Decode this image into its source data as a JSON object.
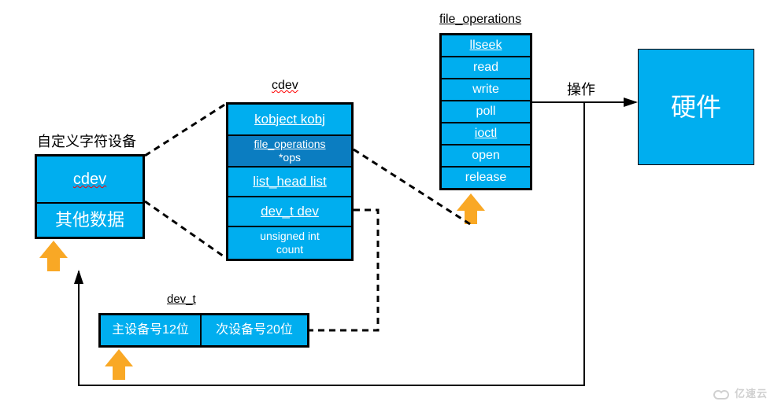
{
  "labels": {
    "custom_device": "自定义字符设备",
    "cdev_title": "cdev",
    "file_ops_title": "file_operations",
    "dev_t_title": "dev_t",
    "operate": "操作",
    "hardware": "硬件",
    "watermark": "亿速云"
  },
  "custom_box": {
    "row1": "cdev",
    "row2": "其他数据"
  },
  "cdev_struct": {
    "r1": "kobject kobj",
    "r2a": "file_operations",
    "r2b": "*ops",
    "r3": "list_head list",
    "r4": "dev_t dev",
    "r5a": "unsigned int",
    "r5b": "count"
  },
  "file_ops": {
    "r1": "llseek",
    "r2": "read",
    "r3": "write",
    "r4": "poll",
    "r5": "ioctl",
    "r6": "open",
    "r7": "release"
  },
  "dev_t": {
    "major": "主设备号12位",
    "minor": "次设备号20位"
  },
  "chart_data": {
    "type": "diagram",
    "nodes": [
      {
        "id": "custom",
        "label": "自定义字符设备",
        "fields": [
          "cdev",
          "其他数据"
        ]
      },
      {
        "id": "cdev",
        "label": "cdev",
        "fields": [
          "kobject kobj",
          "file_operations *ops",
          "list_head list",
          "dev_t dev",
          "unsigned int count"
        ]
      },
      {
        "id": "file_operations",
        "label": "file_operations",
        "fields": [
          "llseek",
          "read",
          "write",
          "poll",
          "ioctl",
          "open",
          "release"
        ]
      },
      {
        "id": "dev_t",
        "label": "dev_t",
        "fields": [
          "主设备号12位",
          "次设备号20位"
        ]
      },
      {
        "id": "hardware",
        "label": "硬件"
      }
    ],
    "edges": [
      {
        "from": "custom.cdev",
        "to": "cdev",
        "style": "dashed",
        "meaning": "expands-to"
      },
      {
        "from": "cdev.file_operations *ops",
        "to": "file_operations",
        "style": "dashed",
        "meaning": "points-to"
      },
      {
        "from": "cdev.dev_t dev",
        "to": "dev_t",
        "style": "dashed",
        "meaning": "expands-to"
      },
      {
        "from": "file_operations",
        "to": "hardware",
        "style": "solid",
        "label": "操作"
      },
      {
        "from": "hardware",
        "to": "custom",
        "style": "solid",
        "meaning": "feedback"
      }
    ]
  }
}
